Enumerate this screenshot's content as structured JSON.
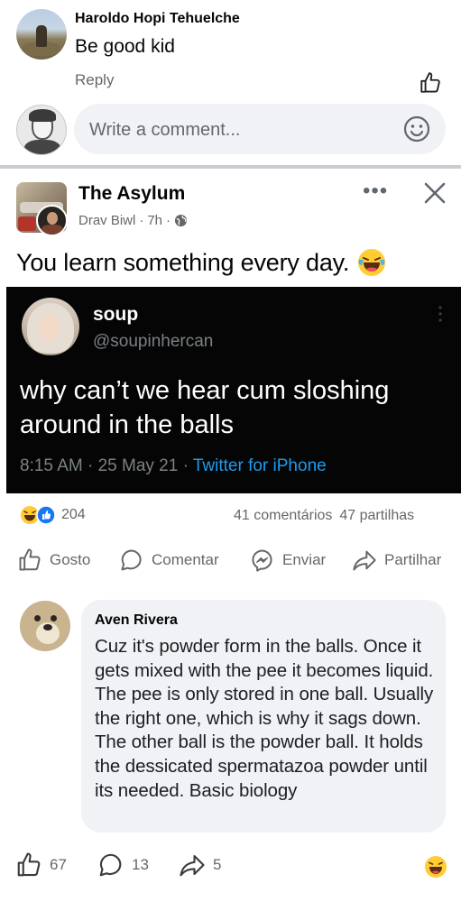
{
  "top_comment": {
    "author": "Haroldo Hopi Tehuelche",
    "text": "Be good kid",
    "reply_label": "Reply"
  },
  "composer": {
    "placeholder": "Write a comment..."
  },
  "post": {
    "page_name": "The Asylum",
    "author": "Drav Biwl",
    "time": "7h",
    "text": "You learn something every day.",
    "tweet": {
      "name": "soup",
      "handle": "@soupinhercan",
      "body": "why can’t we hear cum sloshing around in the balls",
      "timestamp": "8:15 AM · 25 May 21 · ",
      "source": "Twitter for iPhone"
    },
    "reactions_count": "204",
    "comments_count": "41 comentários",
    "shares_count": "47 partilhas",
    "actions": {
      "like": "Gosto",
      "comment": "Comentar",
      "send": "Enviar",
      "share": "Partilhar"
    }
  },
  "reply": {
    "author": "Aven Rivera",
    "text": "Cuz it's powder form in the balls. Once it gets mixed with the pee it becomes liquid. The pee is only stored in one ball. Usually the right one, which is why it sags down. The other ball is the powder ball. It holds the dessicated spermatazoa powder until its needed. Basic biology"
  },
  "bottom_bar": {
    "likes": "67",
    "comments": "13",
    "shares": "5"
  },
  "colors": {
    "secondary_text": "#65676b",
    "bubble_bg": "#f0f2f5",
    "link_blue": "#1d9bf0",
    "tweet_bg": "#050505"
  }
}
